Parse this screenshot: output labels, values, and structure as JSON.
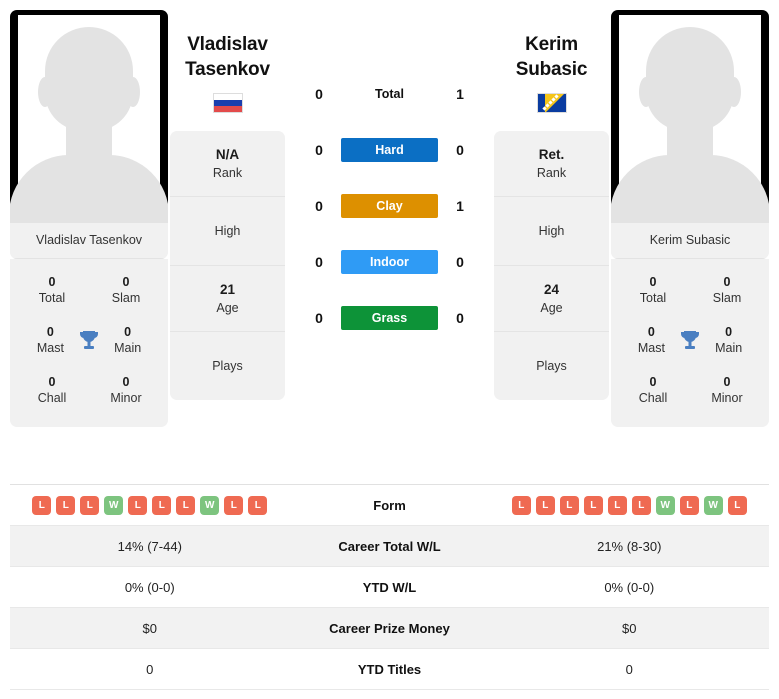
{
  "players": {
    "left": {
      "full_name": "Vladislav Tasenkov",
      "first_name": "Vladislav",
      "last_name": "Tasenkov",
      "flag": "russia-flag",
      "photo": "player-photo-placeholder",
      "titles": {
        "total": "0",
        "total_label": "Total",
        "slam": "0",
        "slam_label": "Slam",
        "mast": "0",
        "mast_label": "Mast",
        "main": "0",
        "main_label": "Main",
        "chall": "0",
        "chall_label": "Chall",
        "minor": "0",
        "minor_label": "Minor",
        "trophy_icon": "trophy-icon"
      },
      "info": {
        "rank_value": "N/A",
        "rank_label": "Rank",
        "high_value": "",
        "high_label": "High",
        "age_value": "21",
        "age_label": "Age",
        "plays_value": "",
        "plays_label": "Plays"
      },
      "form": [
        "L",
        "L",
        "L",
        "W",
        "L",
        "L",
        "L",
        "W",
        "L",
        "L"
      ],
      "career_total_wl": "14% (7-44)",
      "ytd_wl": "0% (0-0)",
      "career_prize_money": "$0",
      "ytd_titles": "0"
    },
    "right": {
      "full_name": "Kerim Subasic",
      "first_name": "Kerim",
      "last_name": "Subasic",
      "flag": "bosnia-flag",
      "photo": "player-photo-placeholder",
      "titles": {
        "total": "0",
        "total_label": "Total",
        "slam": "0",
        "slam_label": "Slam",
        "mast": "0",
        "mast_label": "Mast",
        "main": "0",
        "main_label": "Main",
        "chall": "0",
        "chall_label": "Chall",
        "minor": "0",
        "minor_label": "Minor",
        "trophy_icon": "trophy-icon"
      },
      "info": {
        "rank_value": "Ret.",
        "rank_label": "Rank",
        "high_value": "",
        "high_label": "High",
        "age_value": "24",
        "age_label": "Age",
        "plays_value": "",
        "plays_label": "Plays"
      },
      "form": [
        "L",
        "L",
        "L",
        "L",
        "L",
        "L",
        "W",
        "L",
        "W",
        "L"
      ],
      "career_total_wl": "21% (8-30)",
      "ytd_wl": "0% (0-0)",
      "career_prize_money": "$0",
      "ytd_titles": "0"
    }
  },
  "head_to_head": [
    {
      "label": "Total",
      "left": "0",
      "right": "1",
      "color": "",
      "style": "plain"
    },
    {
      "label": "Hard",
      "left": "0",
      "right": "0",
      "color": "#0b6fc4",
      "style": "filled"
    },
    {
      "label": "Clay",
      "left": "0",
      "right": "1",
      "color": "#dd9000",
      "style": "filled"
    },
    {
      "label": "Indoor",
      "left": "0",
      "right": "0",
      "color": "#2f9bf5",
      "style": "filled"
    },
    {
      "label": "Grass",
      "left": "0",
      "right": "0",
      "color": "#0d9338",
      "style": "filled"
    }
  ],
  "table_rows": [
    {
      "label": "Form",
      "key": "form"
    },
    {
      "label": "Career Total W/L",
      "key": "career_total_wl"
    },
    {
      "label": "YTD W/L",
      "key": "ytd_wl"
    },
    {
      "label": "Career Prize Money",
      "key": "career_prize_money"
    },
    {
      "label": "YTD Titles",
      "key": "ytd_titles"
    }
  ],
  "colors": {
    "win_badge": "#7dc47f",
    "loss_badge": "#ef6a52",
    "card_bg": "#f1f1f1",
    "row_alt_bg": "#f2f2f2"
  }
}
